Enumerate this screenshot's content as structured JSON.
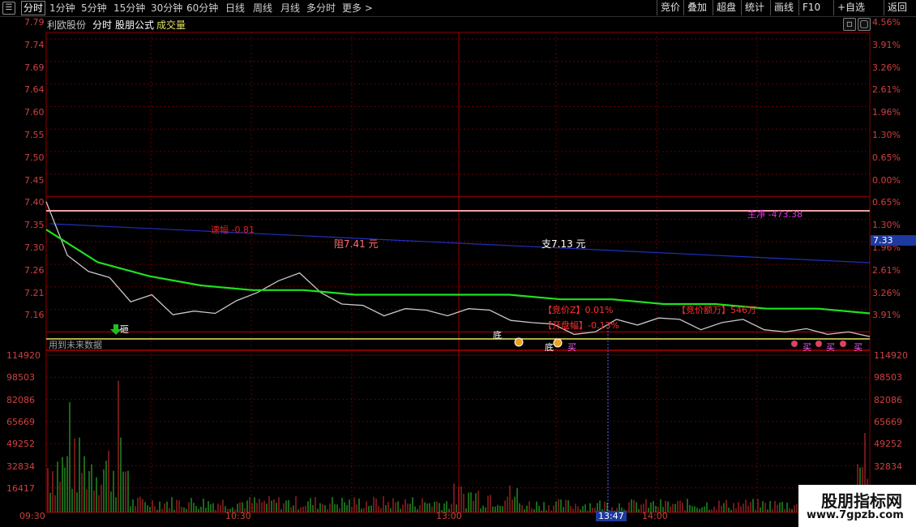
{
  "topbar": {
    "tabs": [
      {
        "label": "分时",
        "active": true
      },
      {
        "label": "1分钟"
      },
      {
        "label": "5分钟"
      },
      {
        "label": "15分钟"
      },
      {
        "label": "30分钟"
      },
      {
        "label": "60分钟"
      },
      {
        "label": "日线"
      },
      {
        "label": "周线"
      },
      {
        "label": "月线"
      },
      {
        "label": "多分时"
      },
      {
        "label": "更多 >"
      }
    ],
    "buttons": [
      "竞价",
      "叠加",
      "超盘",
      "统计",
      "画线",
      "F10",
      "+自选",
      "返回"
    ]
  },
  "header": {
    "stock_name": "利欧股份",
    "mode": "分时",
    "formula": "股朋公式",
    "indicator": "成交量"
  },
  "axes": {
    "price_ticks": [
      "7.79",
      "7.74",
      "7.69",
      "7.64",
      "7.60",
      "7.55",
      "7.50",
      "7.45",
      "7.40",
      "7.35",
      "7.30",
      "7.26",
      "7.21",
      "7.16"
    ],
    "pct_ticks": [
      "4.56%",
      "3.91%",
      "3.26%",
      "2.61%",
      "1.96%",
      "1.30%",
      "0.65%",
      "0.00%",
      "0.65%",
      "1.30%",
      "1.96%",
      "2.61%",
      "3.26%",
      "3.91%"
    ],
    "volume_ticks": [
      "114920",
      "98503",
      "82086",
      "65669",
      "49252",
      "32834",
      "16417"
    ],
    "time_ticks": [
      "09:30",
      "10:30",
      "13:00",
      "14:00"
    ],
    "cursor_time": "13:47",
    "cursor_price": "7.33"
  },
  "annotations": {
    "speed": "速幅 -0.81",
    "resistance": "阻7.41 元",
    "support": "支7.13 元",
    "main_net": "主净 -473.38",
    "auction_z": "【竞价Z】0.01%",
    "auction_amount": "【竞价额万】546万",
    "open_range": "【开盘幅】-0.13%",
    "hammer": "砸",
    "future_data": "用到未来数据",
    "bottom1": "底",
    "bottom2": "底",
    "buy": "买"
  },
  "watermark": {
    "title": "股朋指标网",
    "url": "www.7gpzb.com"
  },
  "colors": {
    "price_line": "#c8c8c8",
    "avg_line": "#20e020",
    "blue_line": "#2030c0",
    "grid": "#800000",
    "support_line": "#e8e860",
    "pink_line": "#f0a0a0"
  },
  "chart_data": {
    "type": "line",
    "price_series_sample": [
      7.44,
      7.33,
      7.29,
      7.27,
      7.23,
      7.24,
      7.19,
      7.21,
      7.2,
      7.22,
      7.25,
      7.27,
      7.28,
      7.25,
      7.22,
      7.21,
      7.2,
      7.21,
      7.2,
      7.2,
      7.21,
      7.2,
      7.19,
      7.18,
      7.17,
      7.16,
      7.16,
      7.18,
      7.18,
      7.19,
      7.18,
      7.17,
      7.18,
      7.18,
      7.17,
      7.16,
      7.16,
      7.16,
      7.16,
      7.15
    ],
    "avg_series_sample": [
      7.38,
      7.31,
      7.28,
      7.26,
      7.25,
      7.25,
      7.24,
      7.24,
      7.24,
      7.24,
      7.23,
      7.23,
      7.22,
      7.22,
      7.21,
      7.21,
      7.2
    ],
    "ylim": [
      7.12,
      7.8
    ],
    "volume_ylim": [
      0,
      131337
    ]
  }
}
